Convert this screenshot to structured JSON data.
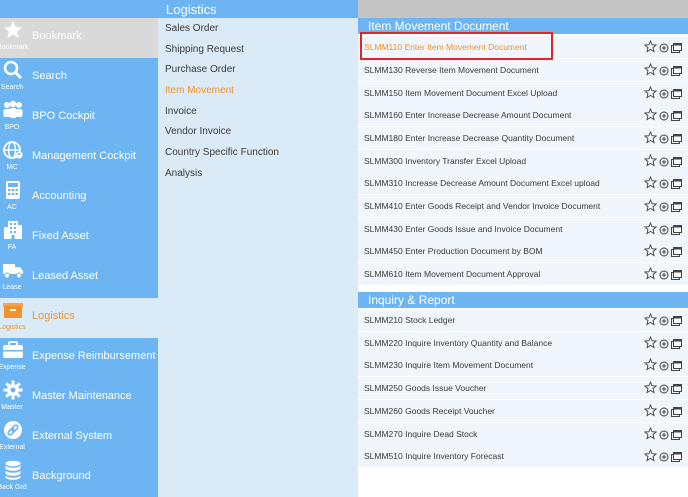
{
  "nav": {
    "items": [
      {
        "label": "Bookmark",
        "abbr": "Bookmark",
        "icon": "star-icon"
      },
      {
        "label": "Search",
        "abbr": "Search",
        "icon": "search-icon"
      },
      {
        "label": "BPO Cockpit",
        "abbr": "BPO",
        "icon": "users-icon"
      },
      {
        "label": "Management Cockpit",
        "abbr": "MC",
        "icon": "globe-icon"
      },
      {
        "label": "Accounting",
        "abbr": "AC",
        "icon": "calculator-icon"
      },
      {
        "label": "Fixed Asset",
        "abbr": "FA",
        "icon": "building-icon"
      },
      {
        "label": "Leased Asset",
        "abbr": "Lease",
        "icon": "truck-icon"
      },
      {
        "label": "Logistics",
        "abbr": "Logistics",
        "icon": "box-icon"
      },
      {
        "label": "Expense Reimbursement",
        "abbr": "Expense",
        "icon": "briefcase-icon"
      },
      {
        "label": "Master Maintenance",
        "abbr": "Master",
        "icon": "gear-icon"
      },
      {
        "label": "External System",
        "abbr": "External",
        "icon": "link-icon"
      },
      {
        "label": "Background",
        "abbr": "Back Grd",
        "icon": "database-icon"
      }
    ],
    "selected": "Logistics"
  },
  "submenu": {
    "title": "Logistics",
    "items": [
      "Sales Order",
      "Shipping Request",
      "Purchase Order",
      "Item Movement",
      "Invoice",
      "Vendor Invoice",
      "Country Specific Function",
      "Analysis"
    ],
    "active": "Item Movement"
  },
  "sections": [
    {
      "title": "Item Movement Document",
      "items": [
        "SLMM110 Enter Item Movement Document",
        "SLMM130 Reverse Item Movement Document",
        "SLMM150 Item Movement Document Excel Upload",
        "SLMM160 Enter Increase Decrease Amount Document",
        "SLMM180 Enter Increase Decrease Quantity Document",
        "SLMM300 Inventory Transfer Excel Upload",
        "SLMM310 Increase Decrease Amount Document Excel upload",
        "SLMM410 Enter Goods Receipt and Vendor Invoice Document",
        "SLMM430 Enter Goods Issue and Invoice Document",
        "SLMM450 Enter Production Document by BOM",
        "SLMM610 Item Movement Document Approval"
      ]
    },
    {
      "title": "Inquiry & Report",
      "items": [
        "SLMM210 Stock Ledger",
        "SLMM220 Inquire Inventory Quantity and Balance",
        "SLMM230 Inquire Item Movement Document",
        "SLMM250 Goods Issue Voucher",
        "SLMM260 Goods Receipt Voucher",
        "SLMM270 Inquire Dead Stock",
        "SLMM510 Inquire Inventory Forecast"
      ]
    }
  ],
  "highlighted_item": "SLMM110 Enter Item Movement Document",
  "row_icons": [
    "star-outline-icon",
    "add-circle-icon",
    "new-window-icon"
  ],
  "colors": {
    "nav_bg": "#6cb4f2",
    "accent": "#f0932b",
    "highlight_border": "#e0242a"
  }
}
